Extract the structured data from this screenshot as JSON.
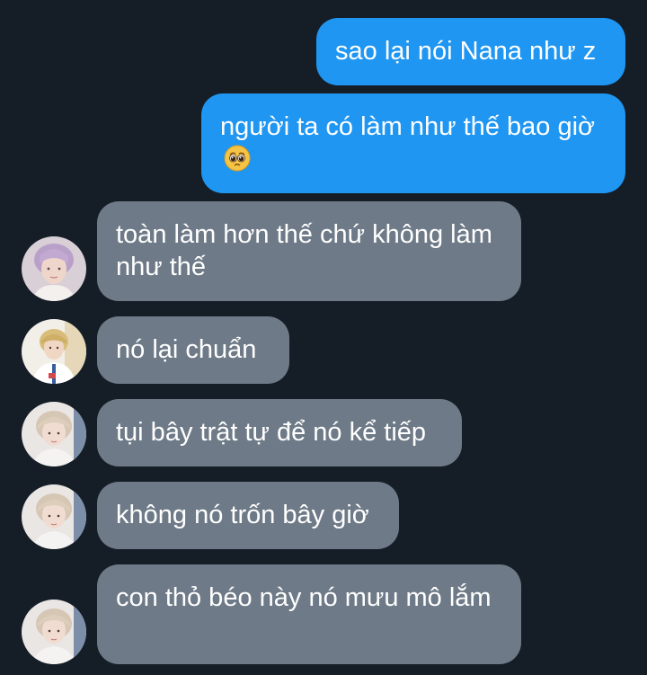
{
  "messages": [
    {
      "id": "m1",
      "direction": "outgoing",
      "text": "sao lại nói Nana như z"
    },
    {
      "id": "m2",
      "direction": "outgoing",
      "text": "người ta có làm như thế bao giờ",
      "emoji": "pleading-face-emoji"
    },
    {
      "id": "m3",
      "direction": "incoming",
      "sender_avatar": "avatar-lavender-hair",
      "text": "toàn làm hơn thế chứ không làm như thế"
    },
    {
      "id": "m4",
      "direction": "incoming",
      "sender_avatar": "avatar-blond-white-shirt",
      "text": "nó lại chuẩn"
    },
    {
      "id": "m5",
      "direction": "incoming",
      "sender_avatar": "avatar-light-hair",
      "text": "tụi bây trật tự để nó kể tiếp"
    },
    {
      "id": "m6",
      "direction": "incoming",
      "sender_avatar": "avatar-light-hair",
      "text": "không nó trốn bây giờ"
    },
    {
      "id": "m7",
      "direction": "incoming",
      "sender_avatar": "avatar-light-hair",
      "text": "con thỏ béo này nó mưu mô lắm"
    }
  ],
  "colors": {
    "background": "#151e27",
    "outgoing_bubble": "#1f96f2",
    "incoming_bubble": "#6e7a87",
    "text": "#ffffff"
  }
}
